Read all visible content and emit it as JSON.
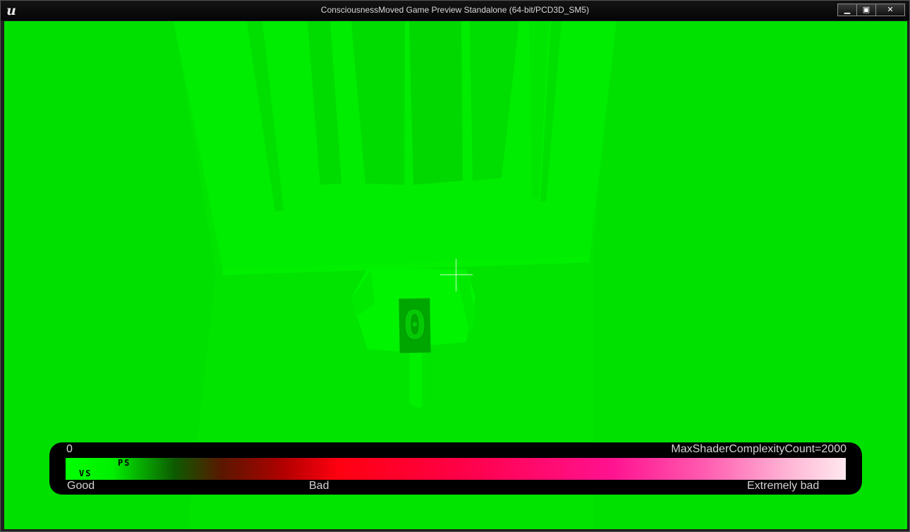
{
  "window": {
    "title": "ConsciousnessMoved Game Preview Standalone (64-bit/PCD3D_SM5)",
    "logo_icon": "unreal-engine-logo",
    "buttons": {
      "minimize_icon": "minimize-icon",
      "maximize_icon": "maximize-icon",
      "close_icon": "close-icon"
    }
  },
  "viewport": {
    "view_mode": "Shader Complexity",
    "score_display": "0"
  },
  "shader_complexity_legend": {
    "min_value": "0",
    "max_label": "MaxShaderComplexityCount=2000",
    "ps_marker": "PS",
    "vs_marker": "VS",
    "label_good": "Good",
    "label_bad": "Bad",
    "label_extremely_bad": "Extremely bad"
  },
  "colors": {
    "viewport_base": "#00e400",
    "legend_background": "#000000"
  }
}
